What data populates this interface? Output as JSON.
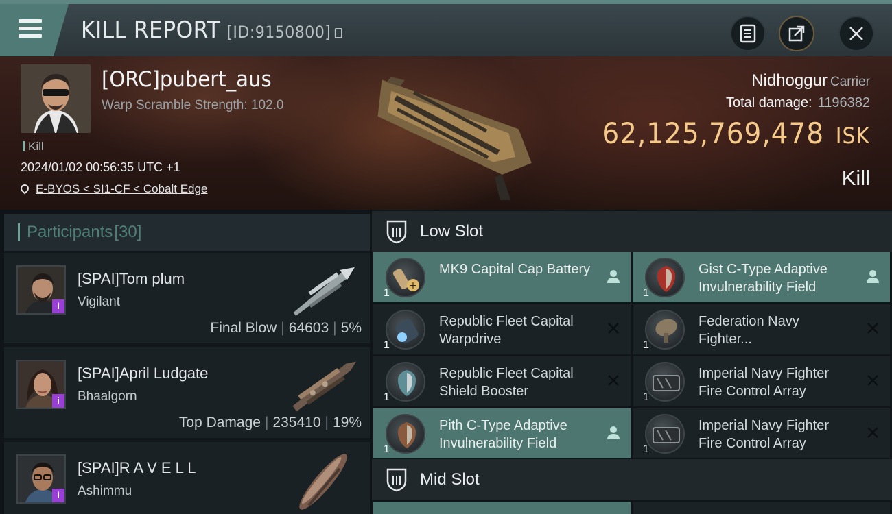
{
  "header": {
    "title": "KILL REPORT",
    "id_text": "[ID:9150800]"
  },
  "victim": {
    "name": "[ORC]pubert_aus",
    "scramble": "Warp Scramble Strength: 102.0",
    "tag": "Kill",
    "datetime": "2024/01/02 00:56:35 UTC +1",
    "location": "E-BYOS < SI1-CF < Cobalt Edge",
    "ship_name": "Nidhoggur",
    "ship_class": "Carrier",
    "total_damage_label": "Total damage:",
    "total_damage": "1196382",
    "isk_value": "62,125,769,478",
    "isk_unit": "ISK",
    "result": "Kill"
  },
  "participants": {
    "label": "Participants",
    "count": "[30]",
    "rows": [
      {
        "name": "[SPAI]Tom plum",
        "ship": "Vigilant",
        "role": "Final Blow",
        "damage": "64603",
        "percent": "5%"
      },
      {
        "name": "[SPAI]April Ludgate",
        "ship": "Bhaalgorn",
        "role": "Top Damage",
        "damage": "235410",
        "percent": "19%"
      },
      {
        "name": "[SPAI]R A V E L L",
        "ship": "Ashimmu"
      }
    ],
    "badge": "i"
  },
  "slots": {
    "low_label": "Low Slot",
    "mid_label": "Mid Slot",
    "low_modules": [
      {
        "name": "MK9 Capital Cap Battery",
        "qty": "1"
      },
      {
        "name": "Gist C-Type Adaptive Invulnerability Field",
        "qty": "1"
      },
      {
        "name": "Republic Fleet Capital Warpdrive",
        "qty": "1"
      },
      {
        "name": "Federation Navy Fighter...",
        "qty": "1"
      },
      {
        "name": "Republic Fleet Capital Shield Booster",
        "qty": "1"
      },
      {
        "name": "Imperial Navy Fighter Fire Control Array",
        "qty": "1"
      },
      {
        "name": "Pith C-Type Adaptive Invulnerability Field",
        "qty": "1"
      },
      {
        "name": "Imperial Navy Fighter Fire Control Array",
        "qty": "1"
      }
    ]
  },
  "colors": {
    "accent": "#4d7670",
    "isk": "#f4c98a",
    "badge": "#9a3fd6"
  }
}
